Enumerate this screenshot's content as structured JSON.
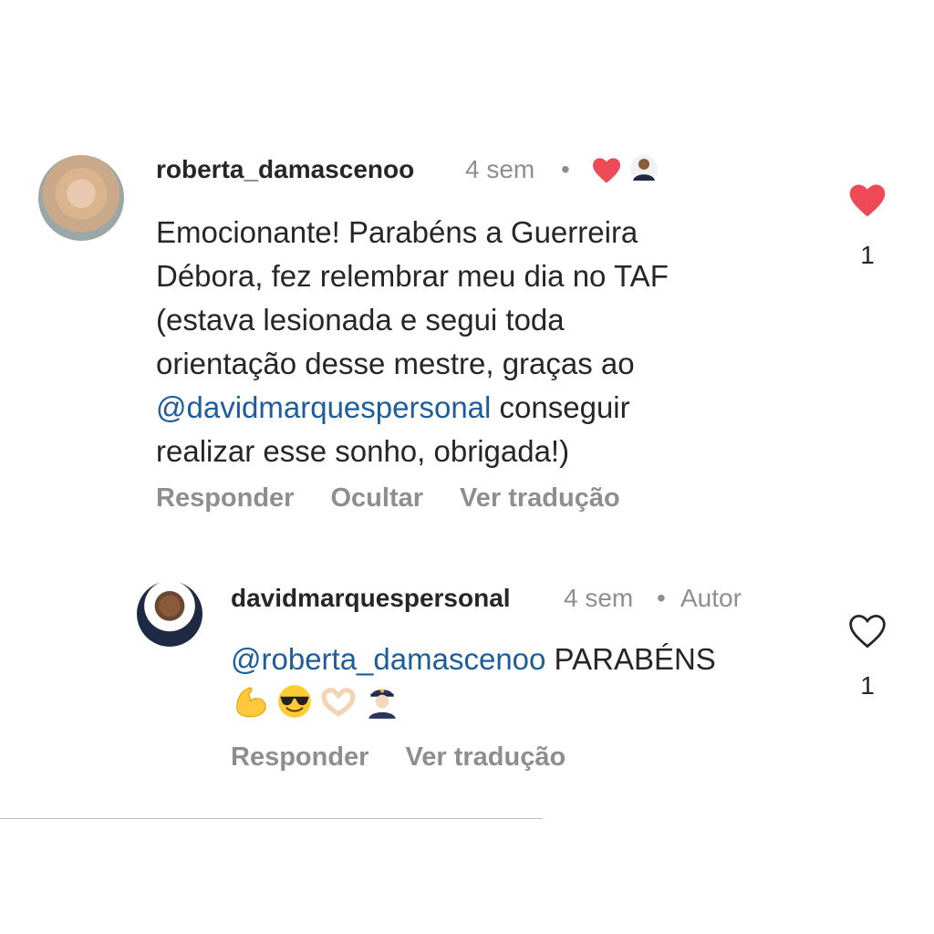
{
  "comment": {
    "username": "roberta_damascenoo",
    "time": "4 sem",
    "lines": [
      {
        "text": "Emocionante! Parabéns a Guerreira"
      },
      {
        "text": "Débora, fez relembrar meu dia no TAF"
      },
      {
        "text": "(estava lesionada e segui toda"
      },
      {
        "text": "orientação desse mestre, graças ao"
      },
      {
        "mention": "@davidmarquespersonal",
        "text": " conseguir"
      },
      {
        "text": "realizar esse sonho, obrigada!)"
      }
    ],
    "actions": [
      "Responder",
      "Ocultar",
      "Ver tradução"
    ],
    "like_count": "1",
    "liked": true
  },
  "reply": {
    "username": "davidmarquespersonal",
    "time": "4 sem",
    "author_badge": "Autor",
    "mention": "@roberta_damascenoo",
    "text": " PARABÉNS",
    "emojis": [
      "flexed-biceps",
      "smiling-face-with-sunglasses",
      "heart-hands",
      "police-officer-woman"
    ],
    "actions": [
      "Responder",
      "Ver tradução"
    ],
    "like_count": "1",
    "liked": false
  },
  "colors": {
    "like_red": "#ed4956",
    "mention_blue": "#1d5d9b",
    "secondary_gray": "#8e8e8e"
  }
}
